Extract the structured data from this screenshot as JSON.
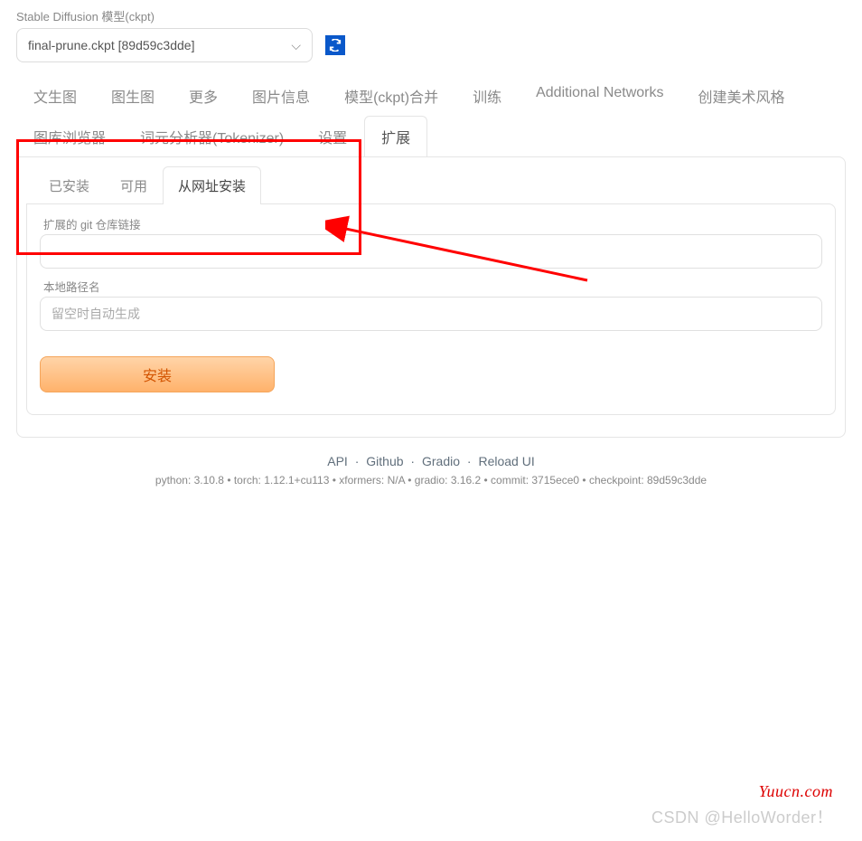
{
  "header": {
    "model_label": "Stable Diffusion 模型(ckpt)",
    "model_value": "final-prune.ckpt [89d59c3dde]"
  },
  "main_tabs": [
    {
      "label": "文生图"
    },
    {
      "label": "图生图"
    },
    {
      "label": "更多"
    },
    {
      "label": "图片信息"
    },
    {
      "label": "模型(ckpt)合并"
    },
    {
      "label": "训练"
    },
    {
      "label": "Additional Networks"
    },
    {
      "label": "创建美术风格"
    },
    {
      "label": "图库浏览器"
    },
    {
      "label": "词元分析器(Tokenizer)"
    },
    {
      "label": "设置"
    },
    {
      "label": "扩展",
      "active": true
    }
  ],
  "sub_tabs": [
    {
      "label": "已安装"
    },
    {
      "label": "可用"
    },
    {
      "label": "从网址安装",
      "active": true
    }
  ],
  "form": {
    "repo_label": "扩展的 git 仓库链接",
    "repo_value": "",
    "local_label": "本地路径名",
    "local_placeholder": "留空时自动生成",
    "install_button": "安装"
  },
  "footer": {
    "links": [
      "API",
      "Github",
      "Gradio",
      "Reload UI"
    ],
    "versions": "python: 3.10.8  •  torch: 1.12.1+cu113  •  xformers: N/A  •  gradio: 3.16.2  •  commit: 3715ece0  •  checkpoint: 89d59c3dde"
  },
  "watermarks": {
    "w1": "Yuucn.com",
    "w2": "CSDN @HelloWorder！"
  }
}
